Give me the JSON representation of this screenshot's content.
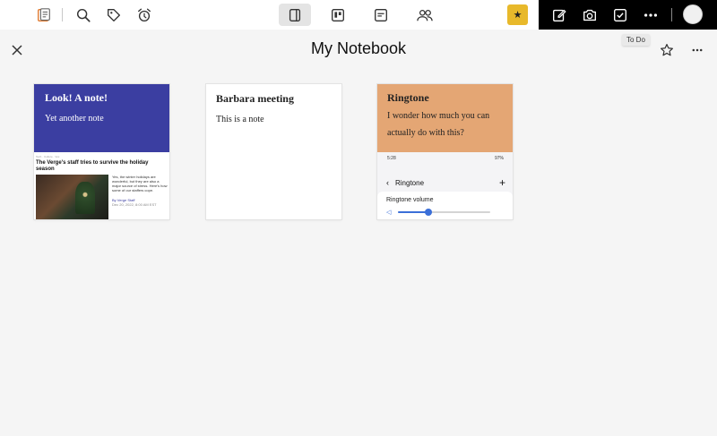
{
  "toolbar": {
    "left_icons": [
      "notes-app-icon",
      "search-icon",
      "tag-icon",
      "alarm-icon"
    ],
    "view_icons": [
      "notebook-view-icon",
      "board-view-icon",
      "note-view-icon",
      "people-icon"
    ],
    "right_icons": [
      "edit-icon",
      "camera-icon",
      "checkbox-icon",
      "more-icon"
    ],
    "star_label": "★"
  },
  "tooltip": {
    "text": "To Do"
  },
  "header": {
    "title": "My Notebook"
  },
  "notes": [
    {
      "title": "Look! A note!",
      "body": "Yet another note",
      "background": "#3b3ea1",
      "article": {
        "meta": "Tech  ·  Culture  ·  Vox",
        "headline": "The Verge's staff tries to survive the holiday season",
        "side_text": "Yes, the winter holidays are wonderful, but they are also a major source of stress. Here's how some of our staffers cope.",
        "byline": "By Verge Staff",
        "date": "Dec 20, 2022, 8:00 AM EST"
      }
    },
    {
      "title": "Barbara meeting",
      "body": "This is a note",
      "background": "#ffffff"
    },
    {
      "title": "Ringtone",
      "body": "I wonder how much you can actually do with this?",
      "background": "#e4a674",
      "phone": {
        "time": "5:28",
        "battery": "97%",
        "screen_title": "Ringtone",
        "volume_label": "Ringtone volume",
        "volume_level": 0.33
      }
    }
  ],
  "colors": {
    "accent_star": "#e8b92b",
    "slider": "#3b6fd8"
  }
}
